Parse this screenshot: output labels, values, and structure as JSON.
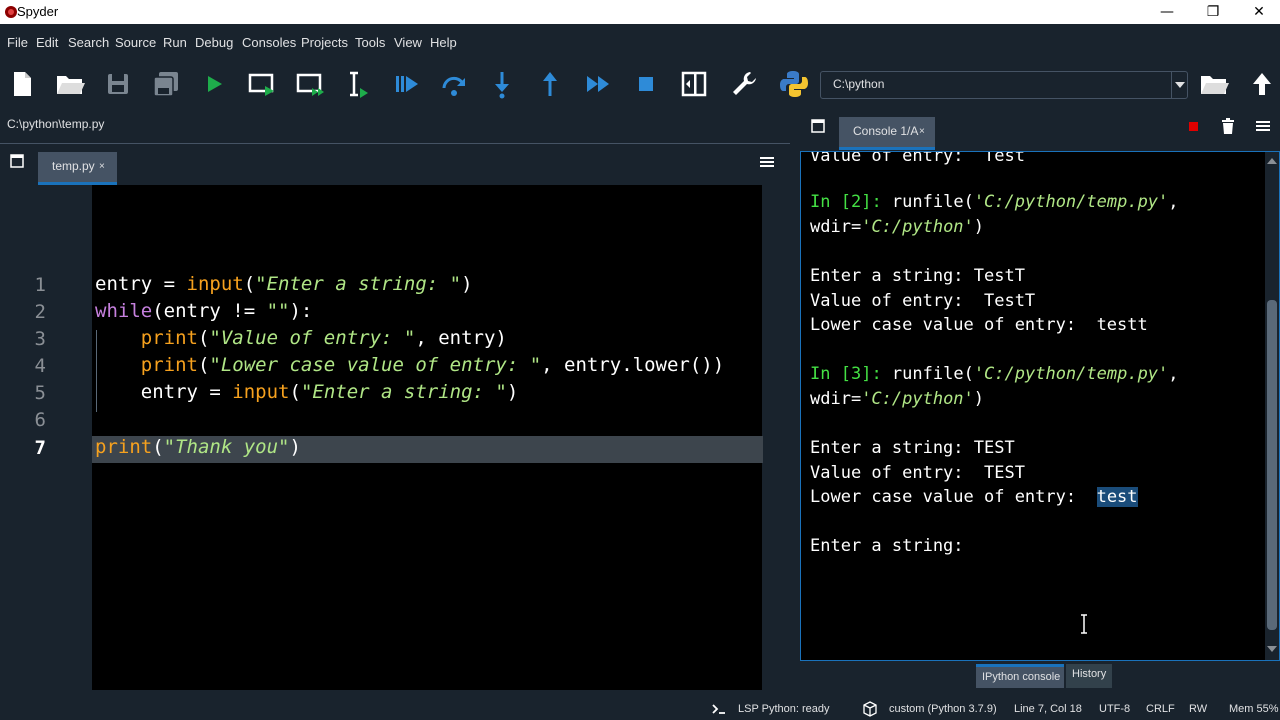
{
  "window": {
    "title": "Spyder",
    "minimize": "—",
    "restore": "❐",
    "close": "✕"
  },
  "menu": [
    "File",
    "Edit",
    "Search",
    "Source",
    "Run",
    "Debug",
    "Consoles",
    "Projects",
    "Tools",
    "View",
    "Help"
  ],
  "toolbar": {
    "path": "C:\\python"
  },
  "editor": {
    "filepath": "C:\\python\\temp.py",
    "tab_label": "temp.py",
    "tab_close": "×",
    "line_numbers": [
      "1",
      "2",
      "3",
      "4",
      "5",
      "6",
      "7"
    ],
    "code": [
      [
        {
          "t": "entry = ",
          "c": ""
        },
        {
          "t": "input",
          "c": "bi"
        },
        {
          "t": "(",
          "c": ""
        },
        {
          "t": "\"Enter a string: \"",
          "c": "st"
        },
        {
          "t": ")",
          "c": ""
        }
      ],
      [
        {
          "t": "while",
          "c": "kwb"
        },
        {
          "t": "(entry != ",
          "c": ""
        },
        {
          "t": "\"\"",
          "c": "st"
        },
        {
          "t": "):",
          "c": ""
        }
      ],
      [
        {
          "t": "    ",
          "c": ""
        },
        {
          "t": "print",
          "c": "bi"
        },
        {
          "t": "(",
          "c": ""
        },
        {
          "t": "\"Value of entry: \"",
          "c": "st"
        },
        {
          "t": ", entry)",
          "c": ""
        }
      ],
      [
        {
          "t": "    ",
          "c": ""
        },
        {
          "t": "print",
          "c": "bi"
        },
        {
          "t": "(",
          "c": ""
        },
        {
          "t": "\"Lower case value of entry: \"",
          "c": "st"
        },
        {
          "t": ", entry.lower())",
          "c": ""
        }
      ],
      [
        {
          "t": "    entry = ",
          "c": ""
        },
        {
          "t": "input",
          "c": "bi"
        },
        {
          "t": "(",
          "c": ""
        },
        {
          "t": "\"Enter a string: \"",
          "c": "st"
        },
        {
          "t": ")",
          "c": ""
        }
      ],
      [],
      [
        {
          "t": "print",
          "c": "bi"
        },
        {
          "t": "(",
          "c": ""
        },
        {
          "t": "\"Thank you\"",
          "c": "st"
        },
        {
          "t": ")",
          "c": ""
        }
      ]
    ]
  },
  "console": {
    "tab_label": "Console 1/A",
    "tab_close": "×",
    "lines": [
      [
        {
          "t": "Value of entry:  Test",
          "c": ""
        }
      ],
      [
        {
          "t": "In [",
          "c": "pr"
        },
        {
          "t": "2",
          "c": "pr"
        },
        {
          "t": "]: ",
          "c": "pr"
        },
        {
          "t": "runfile(",
          "c": ""
        },
        {
          "t": "'C:/python/temp.py'",
          "c": "cst"
        },
        {
          "t": ",",
          "c": ""
        }
      ],
      [
        {
          "t": "wdir=",
          "c": ""
        },
        {
          "t": "'C:/python'",
          "c": "cst"
        },
        {
          "t": ")",
          "c": ""
        }
      ],
      [
        {
          "t": "Enter a string: TestT",
          "c": ""
        }
      ],
      [
        {
          "t": "Value of entry:  TestT",
          "c": ""
        }
      ],
      [
        {
          "t": "Lower case value of entry:  testt",
          "c": ""
        }
      ],
      [
        {
          "t": "In [",
          "c": "pr"
        },
        {
          "t": "3",
          "c": "pr"
        },
        {
          "t": "]: ",
          "c": "pr"
        },
        {
          "t": "runfile(",
          "c": ""
        },
        {
          "t": "'C:/python/temp.py'",
          "c": "cst"
        },
        {
          "t": ",",
          "c": ""
        }
      ],
      [
        {
          "t": "wdir=",
          "c": ""
        },
        {
          "t": "'C:/python'",
          "c": "cst"
        },
        {
          "t": ")",
          "c": ""
        }
      ],
      [
        {
          "t": "Enter a string: TEST",
          "c": ""
        }
      ],
      [
        {
          "t": "Value of entry:  TEST",
          "c": ""
        }
      ],
      [
        {
          "t": "Lower case value of entry:  ",
          "c": ""
        },
        {
          "t": "test",
          "c": "sel"
        }
      ],
      [
        {
          "t": "Enter a string:",
          "c": ""
        }
      ]
    ],
    "bottom_tabs": [
      "IPython console",
      "History"
    ]
  },
  "status": {
    "lsp": "LSP Python: ready",
    "env": "custom (Python 3.7.9)",
    "cursor": "Line 7, Col 18",
    "encoding": "UTF-8",
    "eol": "CRLF",
    "mode": "RW",
    "mem": "Mem 55%"
  },
  "colors": {
    "accent": "#1a72bb",
    "background": "#19232d",
    "run_green": "#1ead4b"
  }
}
